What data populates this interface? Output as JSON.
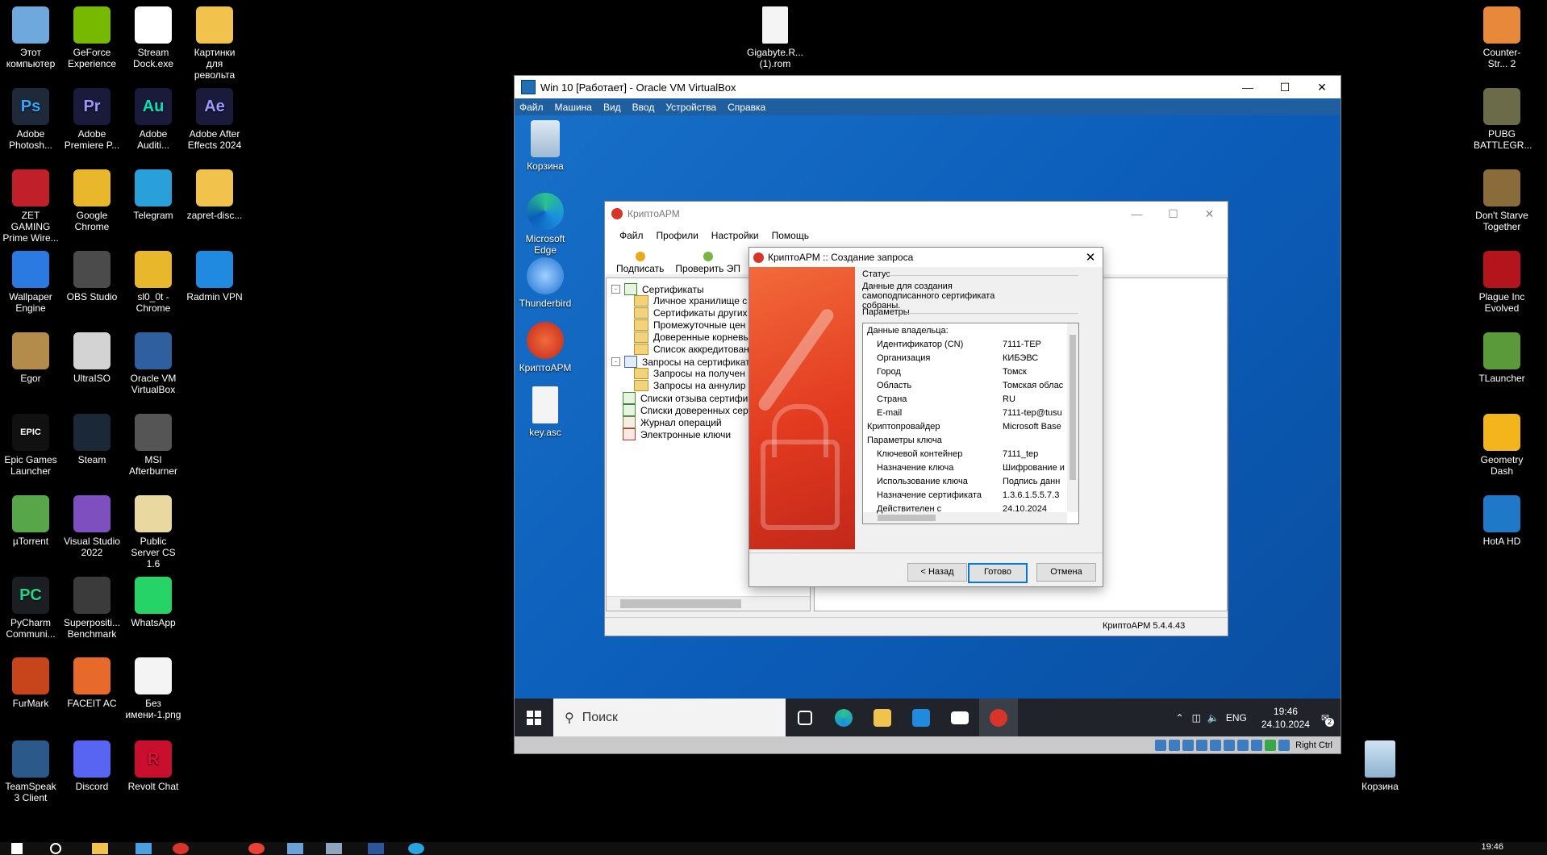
{
  "desktop": {
    "icons_col1": [
      "Этот компьютер",
      "Adobe Photosh...",
      "ZET GAMING Prime Wire...",
      "Wallpaper Engine",
      "Egor",
      "Epic Games Launcher",
      "µTorrent",
      "PyCharm Communi...",
      "FurMark",
      "TeamSpeak 3 Client"
    ],
    "icons_col2": [
      "GeForce Experience",
      "Adobe Premiere P...",
      "Google Chrome",
      "OBS Studio",
      "UltraISO",
      "Steam",
      "Visual Studio 2022",
      "Superpositi... Benchmark",
      "FACEIT AC",
      "Discord"
    ],
    "icons_col3": [
      "Stream Dock.exe",
      "Adobe Auditi...",
      "Telegram",
      "sl0_0t - Chrome",
      "Oracle VM VirtualBox",
      "MSI Afterburner",
      "Public Server CS 1.6",
      "WhatsApp",
      "Без имени-1.png",
      "Revolt Chat"
    ],
    "icons_col4": [
      "Картинки для револьта",
      "Adobe After Effects 2024",
      "zapret-disc...",
      "Radmin VPN"
    ],
    "file_icon": "Gigabyte.R... (1).rom",
    "icons_right": [
      "Counter-Str... 2",
      "PUBG BATTLEGR...",
      "Don't Starve Together",
      "Plague Inc Evolved",
      "TLauncher",
      "Geometry Dash",
      "HotA HD"
    ],
    "recycle_bin": "Корзина",
    "badges": {
      "ps": "Ps",
      "pr": "Pr",
      "au": "Au",
      "ae": "Ae",
      "pc": "PC",
      "epic": "EPIC",
      "revolt": "R"
    }
  },
  "vbox": {
    "title": "Win 10 [Работает] - Oracle VM VirtualBox",
    "menu": [
      "Файл",
      "Машина",
      "Вид",
      "Ввод",
      "Устройства",
      "Справка"
    ],
    "host_key": "Right Ctrl"
  },
  "guest": {
    "icons": [
      "Корзина",
      "Microsoft Edge",
      "Thunderbird",
      "КриптоАРМ",
      "key.asc"
    ],
    "search_placeholder": "Поиск",
    "tray": {
      "lang": "ENG",
      "time": "19:46",
      "date": "24.10.2024",
      "notif": "2"
    }
  },
  "cryptoarm": {
    "title": "КриптоАРМ",
    "menu": [
      "Файл",
      "Профили",
      "Настройки",
      "Помощь"
    ],
    "toolbar": [
      "Подписать",
      "Проверить ЭП"
    ],
    "tree": {
      "certs": "Сертификаты",
      "cert_children": [
        "Личное хранилище с",
        "Сертификаты других",
        "Промежуточные цен",
        "Доверенные корневь",
        "Список аккредитован"
      ],
      "requests": "Запросы на сертификат",
      "request_children": [
        "Запросы на получен",
        "Запросы на аннулир"
      ],
      "others": [
        "Списки отзыва сертифи",
        "Списки доверенных серт",
        "Журнал операций",
        "Электронные ключи"
      ]
    },
    "version": "КриптоАРМ 5.4.4.43"
  },
  "dialog": {
    "title": "КриптоАРМ :: Создание запроса",
    "status_label": "Статус",
    "status_text": "Данные для создания самоподписанного сертификата собраны.",
    "params_label": "Параметры",
    "rows": [
      {
        "k": "Данные владельца:",
        "v": "",
        "indent": false
      },
      {
        "k": "Идентификатор (CN)",
        "v": "7111-ТЕР",
        "indent": true
      },
      {
        "k": "Организация",
        "v": "КИБЭВС",
        "indent": true
      },
      {
        "k": "Город",
        "v": "Томск",
        "indent": true
      },
      {
        "k": "Область",
        "v": "Томская облас",
        "indent": true
      },
      {
        "k": "Страна",
        "v": "RU",
        "indent": true
      },
      {
        "k": "E-mail",
        "v": "7111-tep@tusu",
        "indent": true
      },
      {
        "k": "Криптопровайдер",
        "v": "Microsoft Base",
        "indent": false
      },
      {
        "k": "Параметры ключа",
        "v": "",
        "indent": false
      },
      {
        "k": "Ключевой контейнер",
        "v": "7111_tep",
        "indent": true
      },
      {
        "k": "Назначение ключа",
        "v": "Шифрование и",
        "indent": true
      },
      {
        "k": "Использование ключа",
        "v": "Подпись данн",
        "indent": true
      },
      {
        "k": "Назначение сертификата",
        "v": "1.3.6.1.5.5.7.3",
        "indent": true
      },
      {
        "k": "Действителен с",
        "v": "24.10.2024",
        "indent": true
      }
    ],
    "buttons": {
      "back": "< Назад",
      "done": "Готово",
      "cancel": "Отмена"
    }
  },
  "host_taskbar": {
    "time": "19:46"
  },
  "colors": {
    "vbox_menu": "#1f5fa0",
    "guest_bg": "#0b5db9",
    "accent": "#0078d7"
  }
}
